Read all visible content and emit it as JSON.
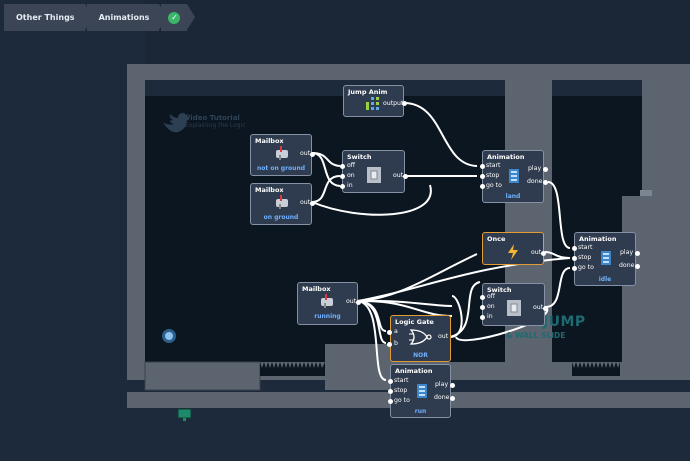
{
  "breadcrumbs": [
    {
      "label": "Other Things"
    },
    {
      "label": "Animations"
    }
  ],
  "status_icon": "check-circle-icon",
  "watermarks": {
    "tutorial_title": "Video Tutorial",
    "tutorial_sub": "Explaining the Logic",
    "level_title": "WALL JUMP",
    "level_sub": "& WALL SLIDE"
  },
  "colors": {
    "highlight": "#e39b36",
    "accent": "#6fb1ff",
    "check": "#3bb56a"
  },
  "nodes": {
    "jump_anim": {
      "title": "Jump Anim",
      "out": "output"
    },
    "mailbox1": {
      "title": "Mailbox",
      "out": "out",
      "sub": "not on ground"
    },
    "mailbox2": {
      "title": "Mailbox",
      "out": "out",
      "sub": "on ground"
    },
    "switch1": {
      "title": "Switch",
      "in1": "off",
      "in2": "on",
      "in3": "in",
      "out": "out"
    },
    "anim_land": {
      "title": "Animation",
      "in1": "start",
      "in2": "stop",
      "in3": "go to",
      "out1": "play",
      "out2": "done",
      "sub": "land"
    },
    "once": {
      "title": "Once",
      "out": "out"
    },
    "anim_idle": {
      "title": "Animation",
      "in1": "start",
      "in2": "stop",
      "in3": "go to",
      "out1": "play",
      "out2": "done",
      "sub": "idle"
    },
    "mailbox3": {
      "title": "Mailbox",
      "out": "out",
      "sub": "running"
    },
    "switch2": {
      "title": "Switch",
      "in1": "off",
      "in2": "on",
      "in3": "in",
      "out": "out"
    },
    "logic_gate": {
      "title": "Logic Gate",
      "in1": "a",
      "in2": "b",
      "out": "out",
      "sub": "NOR"
    },
    "anim_run": {
      "title": "Animation",
      "in1": "start",
      "in2": "stop",
      "in3": "go to",
      "out1": "play",
      "out2": "done",
      "sub": "run"
    }
  }
}
